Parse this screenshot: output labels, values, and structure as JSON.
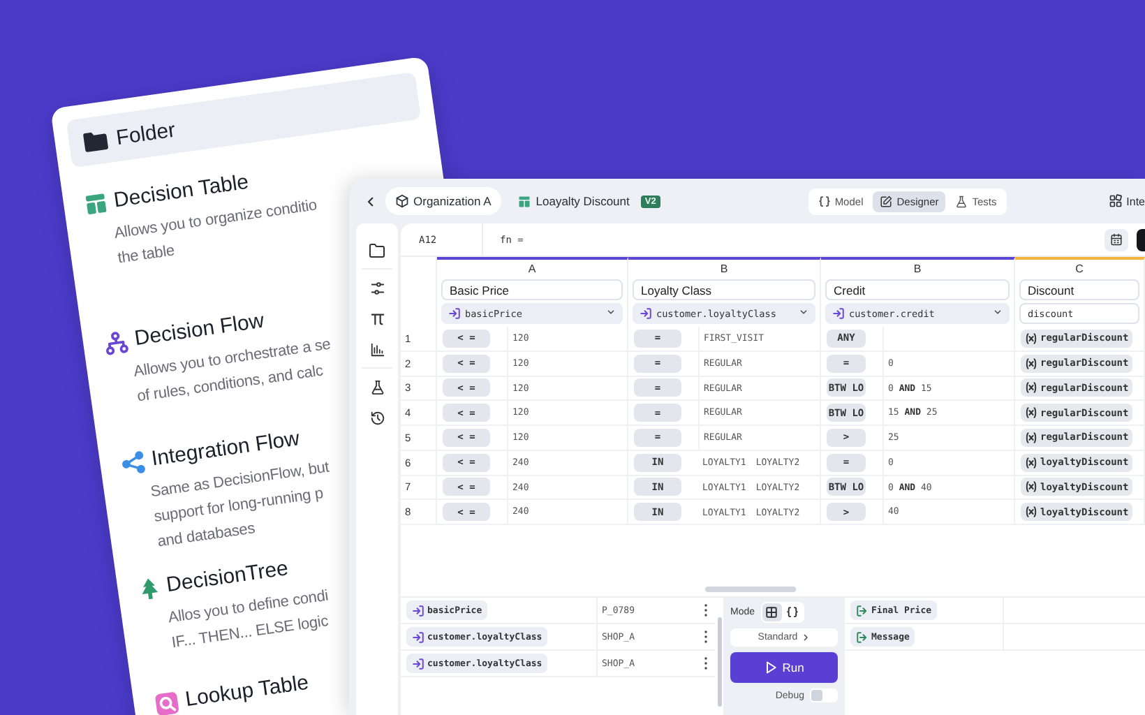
{
  "card": {
    "items": [
      {
        "kind": "folder",
        "title": "Folder",
        "selected": true
      },
      {
        "kind": "table",
        "title": "Decision Table",
        "selected": false,
        "lines": [
          "Allows you to organize conditio",
          "the table"
        ]
      },
      {
        "kind": "flow",
        "title": "Decision Flow",
        "selected": false,
        "lines": [
          "Allows you to orchestrate a se",
          "of rules, conditions, and calc"
        ]
      },
      {
        "kind": "integration",
        "title": "Integration Flow",
        "selected": false,
        "lines": [
          "Same as DecisionFlow, but",
          "support for long-running p",
          "and databases"
        ]
      },
      {
        "kind": "tree",
        "title": "DecisionTree",
        "selected": false,
        "lines": [
          "Allos you to define condi",
          "IF... THEN... ELSE logic"
        ]
      },
      {
        "kind": "lookup",
        "title": "Lookup Table",
        "selected": false
      }
    ]
  },
  "toolbar": {
    "organization": "Organization A",
    "document": "Loayalty Discount",
    "version": "V2",
    "view_tabs": [
      {
        "kind": "model",
        "label": "Model",
        "selected": false
      },
      {
        "kind": "designer",
        "label": "Designer",
        "selected": true
      },
      {
        "kind": "tests",
        "label": "Tests",
        "selected": false
      }
    ],
    "integrations": "Inte"
  },
  "formula_bar": {
    "cell": "A12",
    "formula": "fn ="
  },
  "table": {
    "columns": [
      {
        "kind": "input",
        "letter": "A",
        "name": "Basic Price",
        "variable": "basicPrice"
      },
      {
        "kind": "input",
        "letter": "B",
        "name": "Loyalty Class",
        "variable": "customer.loyaltyClass"
      },
      {
        "kind": "input",
        "letter": "B",
        "name": "Credit",
        "variable": "customer.credit"
      },
      {
        "kind": "output",
        "letter": "C",
        "name": "Discount",
        "variable": "discount"
      }
    ],
    "rows": [
      {
        "number": "1",
        "conditions": [
          {
            "operator": "< =",
            "value": "120"
          },
          {
            "operator": "=",
            "value": "FIRST_VISIT"
          },
          {
            "operator": "ANY"
          }
        ],
        "result": "regularDiscount"
      },
      {
        "number": "2",
        "conditions": [
          {
            "operator": "< =",
            "value": "120"
          },
          {
            "operator": "=",
            "value": "REGULAR"
          },
          {
            "operator": "=",
            "value": "0"
          }
        ],
        "result": "regularDiscount"
      },
      {
        "number": "3",
        "conditions": [
          {
            "operator": "< =",
            "value": "120"
          },
          {
            "operator": "=",
            "value": "REGULAR"
          },
          {
            "operator": "BTW LO",
            "value": "0 **AND** 15"
          }
        ],
        "result": "regularDiscount"
      },
      {
        "number": "4",
        "conditions": [
          {
            "operator": "< =",
            "value": "120"
          },
          {
            "operator": "=",
            "value": "REGULAR"
          },
          {
            "operator": "BTW LO",
            "value": "15 **AND** 25"
          }
        ],
        "result": "regularDiscount"
      },
      {
        "number": "5",
        "conditions": [
          {
            "operator": "< =",
            "value": "120"
          },
          {
            "operator": "=",
            "value": "REGULAR"
          },
          {
            "operator": ">",
            "value": "25"
          }
        ],
        "result": "regularDiscount"
      },
      {
        "number": "6",
        "conditions": [
          {
            "operator": "< =",
            "value": "240"
          },
          {
            "operator": "IN",
            "values": [
              "LOYALTY1",
              "LOYALTY2"
            ]
          },
          {
            "operator": "=",
            "value": "0"
          }
        ],
        "result": "loyaltyDiscount"
      },
      {
        "number": "7",
        "conditions": [
          {
            "operator": "< =",
            "value": "240"
          },
          {
            "operator": "IN",
            "values": [
              "LOYALTY1",
              "LOYALTY2"
            ]
          },
          {
            "operator": "BTW LO",
            "value": "0 **AND** 40"
          }
        ],
        "result": "loyaltyDiscount"
      },
      {
        "number": "8",
        "conditions": [
          {
            "operator": "< =",
            "value": "240"
          },
          {
            "operator": "IN",
            "values": [
              "LOYALTY1",
              "LOYALTY2"
            ]
          },
          {
            "operator": ">",
            "value": "40"
          }
        ],
        "result": "loyaltyDiscount"
      }
    ]
  },
  "test_panel": {
    "inputs": [
      {
        "variable": "basicPrice",
        "value": "P_0789"
      },
      {
        "variable": "customer.loyaltyClass",
        "value": "SHOP_A"
      },
      {
        "variable": "customer.loyaltyClass",
        "value": "SHOP_A"
      }
    ],
    "mode_label": "Mode",
    "modes": [
      {
        "kind": "grid",
        "selected": true
      },
      {
        "kind": "json",
        "selected": false
      }
    ],
    "profile": "Standard",
    "run": "Run",
    "debug": {
      "label": "Debug",
      "on": false
    },
    "outputs": [
      "Final Price",
      "Message"
    ]
  }
}
